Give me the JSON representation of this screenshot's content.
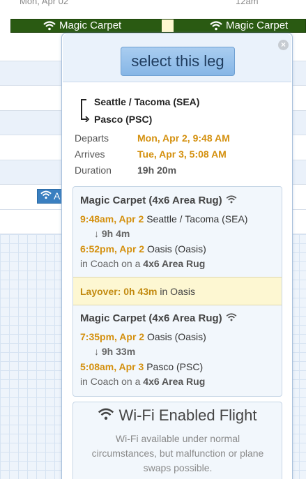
{
  "header": {
    "date": "Mon, Apr 02",
    "time": "12am"
  },
  "flight_bar": {
    "segment1_label": "Magic Carpet",
    "segment2_label": "Magic Carpet"
  },
  "small_bar": {
    "label": "A"
  },
  "popup": {
    "select_button": "select this leg",
    "close_icon": "×",
    "route": {
      "from": "Seattle / Tacoma (SEA)",
      "to": "Pasco (PSC)"
    },
    "details": [
      {
        "label": "Departs",
        "value": "Mon, Apr 2, 9:48 AM",
        "color": "#d4900e"
      },
      {
        "label": "Arrives",
        "value": "Tue, Apr 3, 5:08 AM",
        "color": "#d4900e"
      },
      {
        "label": "Duration",
        "value": "19h 20m",
        "color": "#555555"
      }
    ],
    "legs": [
      {
        "title": "Magic Carpet (4x6 Area Rug)",
        "depart_time": "9:48am, Apr 2",
        "depart_place": "Seattle / Tacoma (SEA)",
        "duration": "9h 4m",
        "arrive_time": "6:52pm, Apr 2",
        "arrive_place": "Oasis (Oasis)",
        "cabin_prefix": "in Coach on a",
        "cabin_aircraft": "4x6 Area Rug"
      },
      {
        "title": "Magic Carpet (4x6 Area Rug)",
        "depart_time": "7:35pm, Apr 2",
        "depart_place": "Oasis (Oasis)",
        "duration": "9h 33m",
        "arrive_time": "5:08am, Apr 3",
        "arrive_place": "Pasco (PSC)",
        "cabin_prefix": "in Coach on a",
        "cabin_aircraft": "4x6 Area Rug"
      }
    ],
    "layover": {
      "label": "Layover:",
      "duration": "0h 43m",
      "suffix": "in Oasis"
    },
    "wifi": {
      "title": "Wi-Fi Enabled Flight",
      "description": "Wi-Fi available under normal circumstances, but malfunction or plane swaps possible."
    }
  },
  "colors": {
    "accent_orange": "#d4900e",
    "flight_bar": "#2a5a12",
    "button_blue": "#86b6e6"
  },
  "icons": [
    "wifi-icon",
    "close-icon",
    "down-arrow-icon",
    "route-bracket-icon"
  ]
}
